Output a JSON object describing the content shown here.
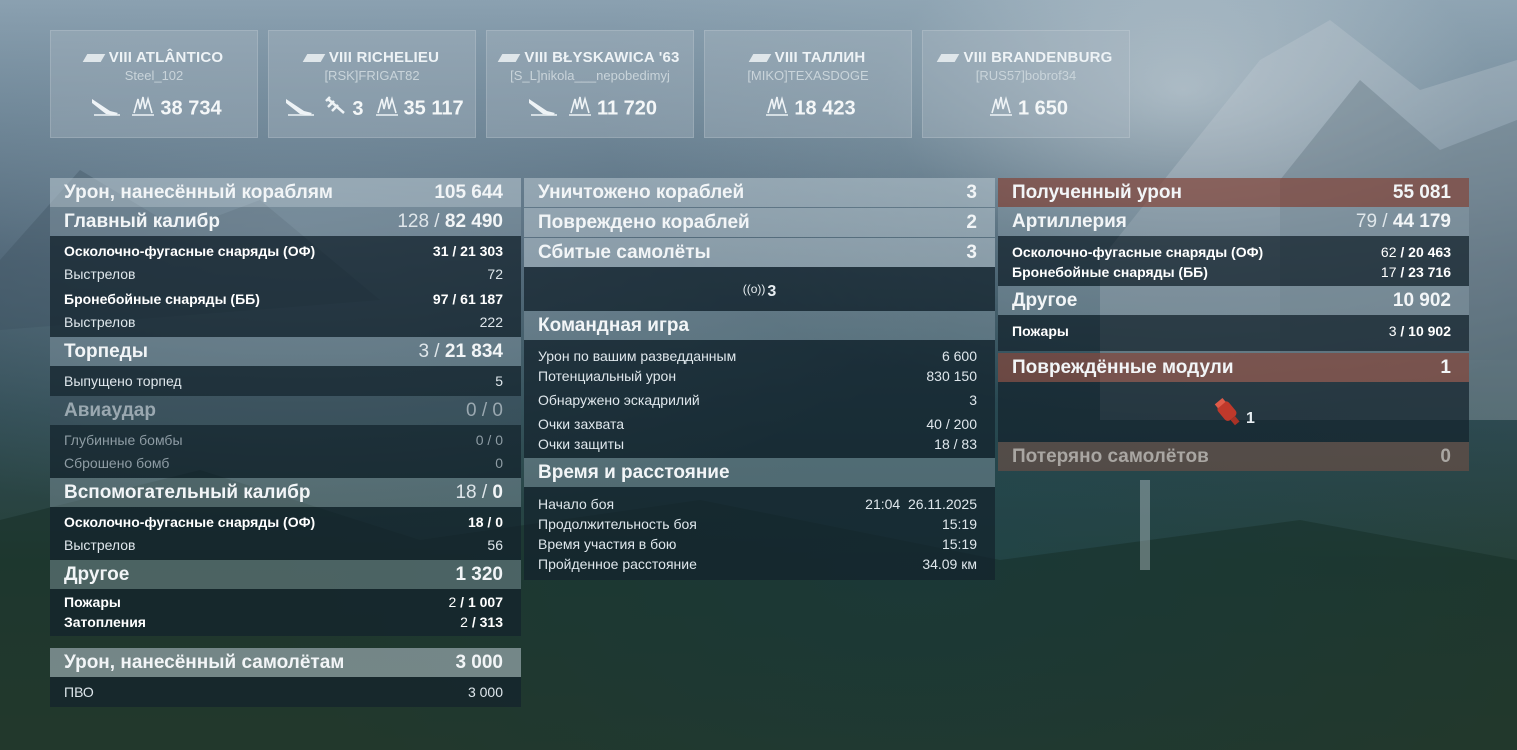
{
  "players": [
    {
      "ship": "VIII ATLÂNTICO",
      "player": "Steel_102",
      "icons": [
        "torpedo-hit-icon",
        "damage-icon"
      ],
      "damage": "38 734",
      "planes": ""
    },
    {
      "ship": "VIII RICHELIEU",
      "player": "[RSK]FRIGAT82",
      "icons": [
        "torpedo-hit-icon",
        "plane-shot-icon",
        "damage-icon"
      ],
      "damage": "35 117",
      "planes": "3"
    },
    {
      "ship": "VIII BŁYSKAWICA '63",
      "player": "[S_L]nikola___nepobedimyj",
      "icons": [
        "torpedo-hit-icon",
        "damage-icon"
      ],
      "damage": "11 720",
      "planes": ""
    },
    {
      "ship": "VIII ТАЛЛИН",
      "player": "[MIKO]TEXASDOGE",
      "icons": [
        "damage-icon"
      ],
      "damage": "18 423",
      "planes": ""
    },
    {
      "ship": "VIII BRANDENBURG",
      "player": "[RUS57]bobrof34",
      "icons": [
        "damage-icon"
      ],
      "damage": "1 650",
      "planes": ""
    }
  ],
  "left": {
    "dmg_ships": {
      "label": "Урон, нанесённый кораблям",
      "value": "105 644"
    },
    "main_caliber": {
      "label": "Главный калибр",
      "hits": "128",
      "value": "82 490"
    },
    "he": {
      "label": "Осколочно-фугасные снаряды (ОФ)",
      "hits": "31",
      "value": "21 303"
    },
    "he_shots": {
      "label": "Выстрелов",
      "value": "72"
    },
    "ap": {
      "label": "Бронебойные снаряды (ББ)",
      "hits": "97",
      "value": "61 187"
    },
    "ap_shots": {
      "label": "Выстрелов",
      "value": "222"
    },
    "torpedoes": {
      "label": "Торпеды",
      "hits": "3",
      "value": "21 834"
    },
    "torp_fired": {
      "label": "Выпущено торпед",
      "value": "5"
    },
    "airstrike": {
      "label": "Авиаудар",
      "value": "0 / 0"
    },
    "depth": {
      "label": "Глубинные бомбы",
      "value": "0 / 0"
    },
    "bombs_dropped": {
      "label": "Сброшено бомб",
      "value": "0"
    },
    "secondary": {
      "label": "Вспомогательный калибр",
      "hits": "18",
      "value": "0"
    },
    "sec_he": {
      "label": "Осколочно-фугасные снаряды (ОФ)",
      "hits": "18",
      "value": "0"
    },
    "sec_shots": {
      "label": "Выстрелов",
      "value": "56"
    },
    "other": {
      "label": "Другое",
      "value": "1 320"
    },
    "fires": {
      "label": "Пожары",
      "hits": "2",
      "value": "1 007"
    },
    "floods": {
      "label": "Затопления",
      "hits": "2",
      "value": "313"
    },
    "dmg_planes": {
      "label": "Урон, нанесённый самолётам",
      "value": "3 000"
    },
    "aa": {
      "label": "ПВО",
      "value": "3 000"
    }
  },
  "mid": {
    "destroyed": {
      "label": "Уничтожено кораблей",
      "value": "3"
    },
    "damaged": {
      "label": "Повреждено кораблей",
      "value": "2"
    },
    "planes_down": {
      "label": "Сбитые самолёты",
      "value": "3"
    },
    "spotted_count": "3",
    "team_title": "Командная игра",
    "spot_dmg": {
      "label": "Урон по вашим разведданным",
      "value": "6 600"
    },
    "potential": {
      "label": "Потенциальный урон",
      "value": "830 150"
    },
    "squadrons": {
      "label": "Обнаружено эскадрилий",
      "value": "3"
    },
    "capture": {
      "label": "Очки захвата",
      "value": "40 / 200"
    },
    "defense": {
      "label": "Очки защиты",
      "value": "18 / 83"
    },
    "time_title": "Время и расстояние",
    "start": {
      "label": "Начало боя",
      "value": "21:04  26.11.2025"
    },
    "duration": {
      "label": "Продолжительность боя",
      "value": "15:19"
    },
    "participation": {
      "label": "Время участия в бою",
      "value": "15:19"
    },
    "distance": {
      "label": "Пройденное расстояние",
      "value": "34.09 км"
    }
  },
  "right": {
    "received": {
      "label": "Полученный урон",
      "value": "55 081"
    },
    "artillery": {
      "label": "Артиллерия",
      "hits": "79",
      "value": "44 179"
    },
    "he": {
      "label": "Осколочно-фугасные снаряды (ОФ)",
      "hits": "62",
      "value": "20 463"
    },
    "ap": {
      "label": "Бронебойные снаряды (ББ)",
      "hits": "17",
      "value": "23 716"
    },
    "other": {
      "label": "Другое",
      "value": "10 902"
    },
    "fires": {
      "label": "Пожары",
      "hits": "3",
      "value": "10 902"
    },
    "modules": {
      "label": "Повреждённые модули",
      "value": "1"
    },
    "module_count": "1",
    "planes_lost": {
      "label": "Потеряно самолётов",
      "value": "0"
    }
  },
  "colors": {
    "accent_red": "#c0392b",
    "header_light": "#b9c8d2",
    "panel_dark": "#14232d"
  }
}
